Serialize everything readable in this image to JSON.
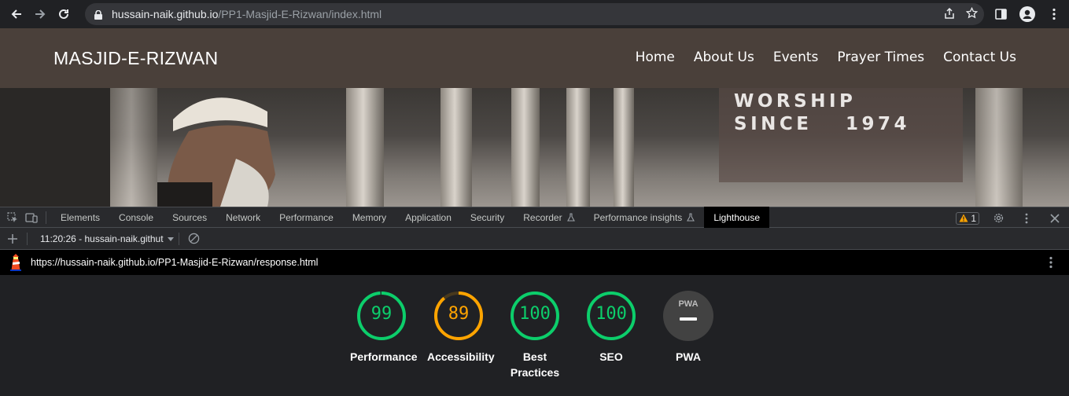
{
  "browser": {
    "url_host": "hussain-naik.github.io",
    "url_path": "/PP1-Masjid-E-Rizwan/index.html"
  },
  "site": {
    "logo": "MASJID-E-RIZWAN",
    "nav": [
      "Home",
      "About Us",
      "Events",
      "Prayer Times",
      "Contact Us"
    ],
    "tagline": "WORSHIP SINCE 1974"
  },
  "devtools": {
    "tabs": [
      "Elements",
      "Console",
      "Sources",
      "Network",
      "Performance",
      "Memory",
      "Application",
      "Security",
      "Recorder",
      "Performance insights",
      "Lighthouse"
    ],
    "active_tab": "Lighthouse",
    "warning_count": "1",
    "report_selector": "11:20:26 - hussain-naik.githut",
    "report_url": "https://hussain-naik.github.io/PP1-Masjid-E-Rizwan/response.html"
  },
  "lighthouse": {
    "scores": [
      {
        "label": "Performance",
        "value": "99",
        "fraction": 0.99,
        "color": "#0cce6b"
      },
      {
        "label": "Accessibility",
        "value": "89",
        "fraction": 0.89,
        "color": "#ffa400"
      },
      {
        "label": "Best Practices",
        "value": "100",
        "fraction": 1.0,
        "color": "#0cce6b"
      },
      {
        "label": "SEO",
        "value": "100",
        "fraction": 1.0,
        "color": "#0cce6b"
      }
    ],
    "pwa_label": "PWA",
    "pwa_badge": "PWA"
  },
  "colors": {
    "pass": "#0cce6b",
    "average": "#ffa400",
    "header_bg": "#4a403a"
  }
}
